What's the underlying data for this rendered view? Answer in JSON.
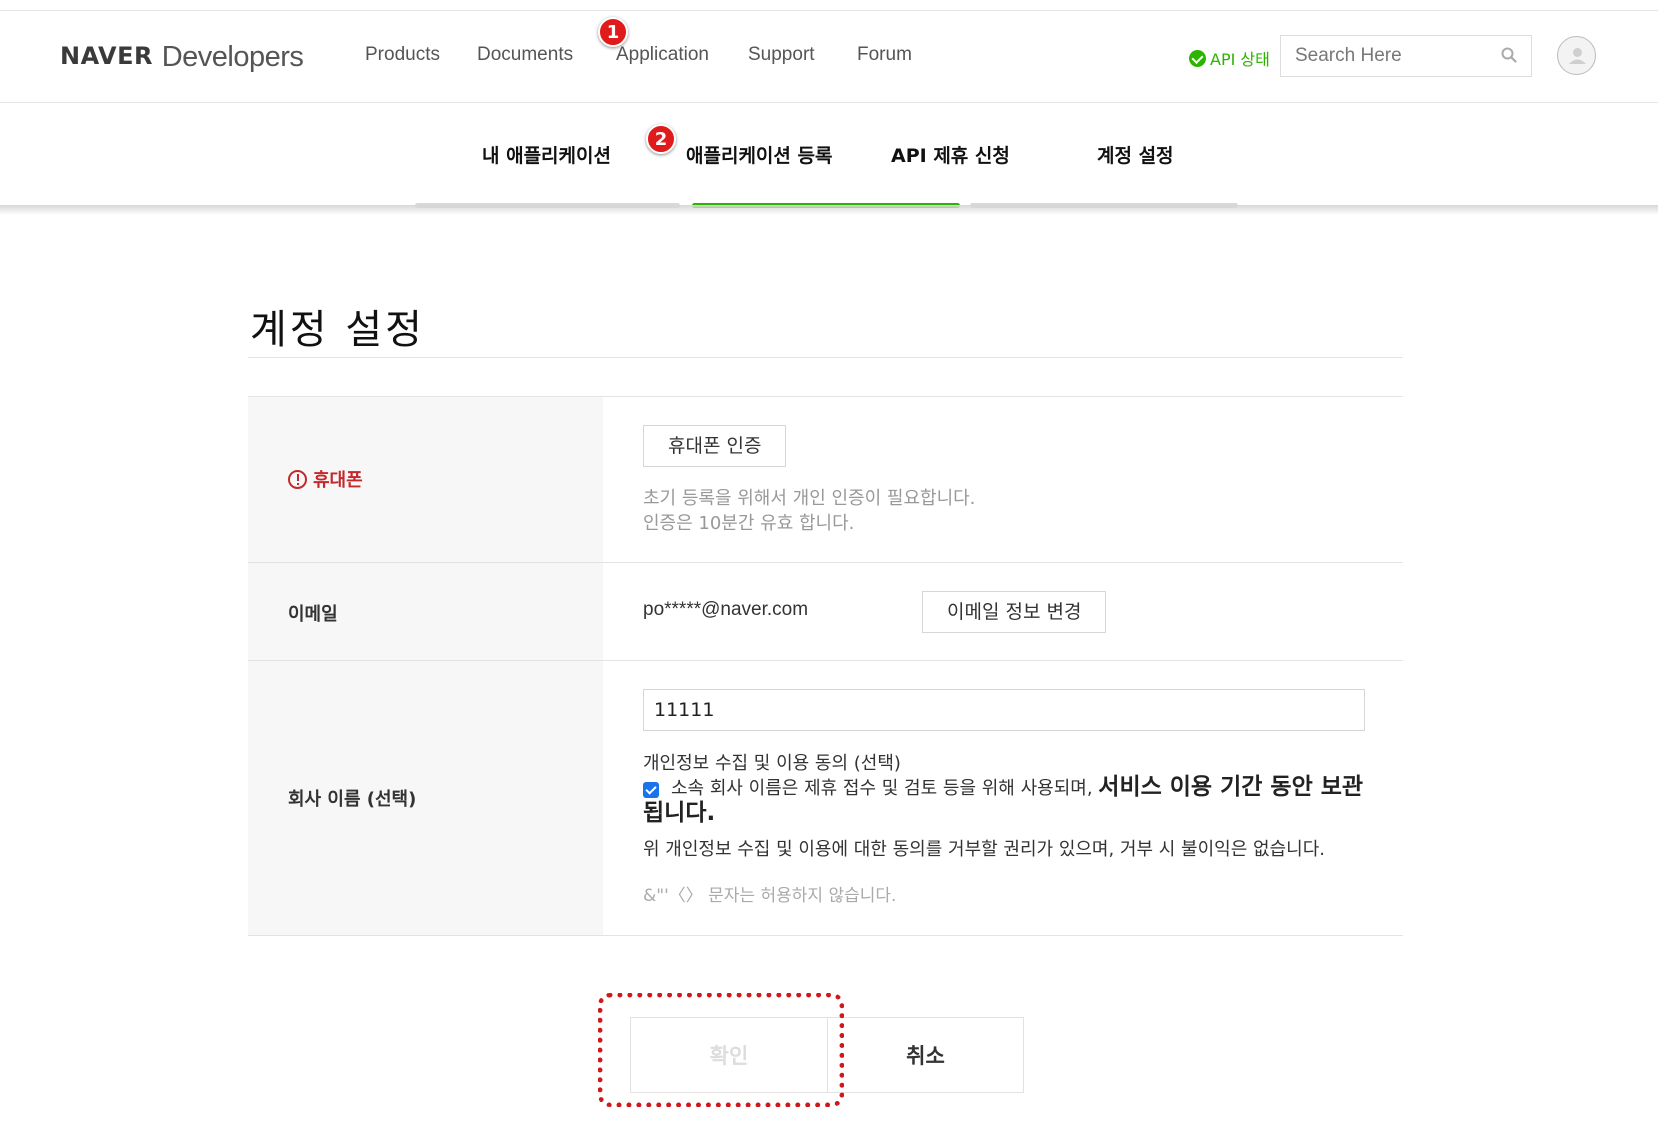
{
  "header": {
    "logo": {
      "brand": "NAVER",
      "product": "Developers"
    },
    "nav": [
      {
        "label": "Products"
      },
      {
        "label": "Documents"
      },
      {
        "label": "Application"
      },
      {
        "label": "Support"
      },
      {
        "label": "Forum"
      }
    ],
    "api_status": {
      "label": "API 상태",
      "color": "#2db400",
      "icon": "check-circle-icon"
    },
    "search": {
      "placeholder": "Search Here",
      "icon": "search-icon"
    },
    "avatar_icon": "user-icon"
  },
  "annotations": {
    "marker_1": "1",
    "marker_2": "2",
    "marker_color": "#e01b1b",
    "highlight_color": "#d0181b"
  },
  "subnav": {
    "items": [
      {
        "label": "내 애플리케이션"
      },
      {
        "label": "애플리케이션 등록"
      },
      {
        "label": "API 제휴 신청"
      },
      {
        "label": "계정 설정"
      }
    ],
    "active_color": "#2db400"
  },
  "page": {
    "title": "계정 설정"
  },
  "form": {
    "phone": {
      "label": "휴대폰",
      "label_color": "#c5282b",
      "icon": "exclamation-circle-icon",
      "verify_button": "휴대폰 인증",
      "help_lines": [
        "초기 등록을 위해서 개인 인증이 필요합니다.",
        "인증은 10분간 유효 합니다."
      ]
    },
    "email": {
      "label": "이메일",
      "value": "po*****@naver.com",
      "change_button": "이메일 정보 변경"
    },
    "company": {
      "label": "회사 이름 (선택)",
      "value": "11111",
      "consent_title": "개인정보 수집 및 이용 동의 (선택)",
      "consent_checked": true,
      "consent_text": "소속 회사 이름은 제휴 접수 및 검토 등을 위해 사용되며,",
      "consent_strong": "서비스 이용 기간 동안 보관됩니다.",
      "consent_note": "위 개인정보 수집 및 이용에 대한 동의를 거부할 권리가 있으며, 거부 시 불이익은 없습니다.",
      "chars_note": "&\"'〈〉 문자는 허용하지 않습니다."
    }
  },
  "actions": {
    "confirm": "확인",
    "cancel": "취소"
  }
}
